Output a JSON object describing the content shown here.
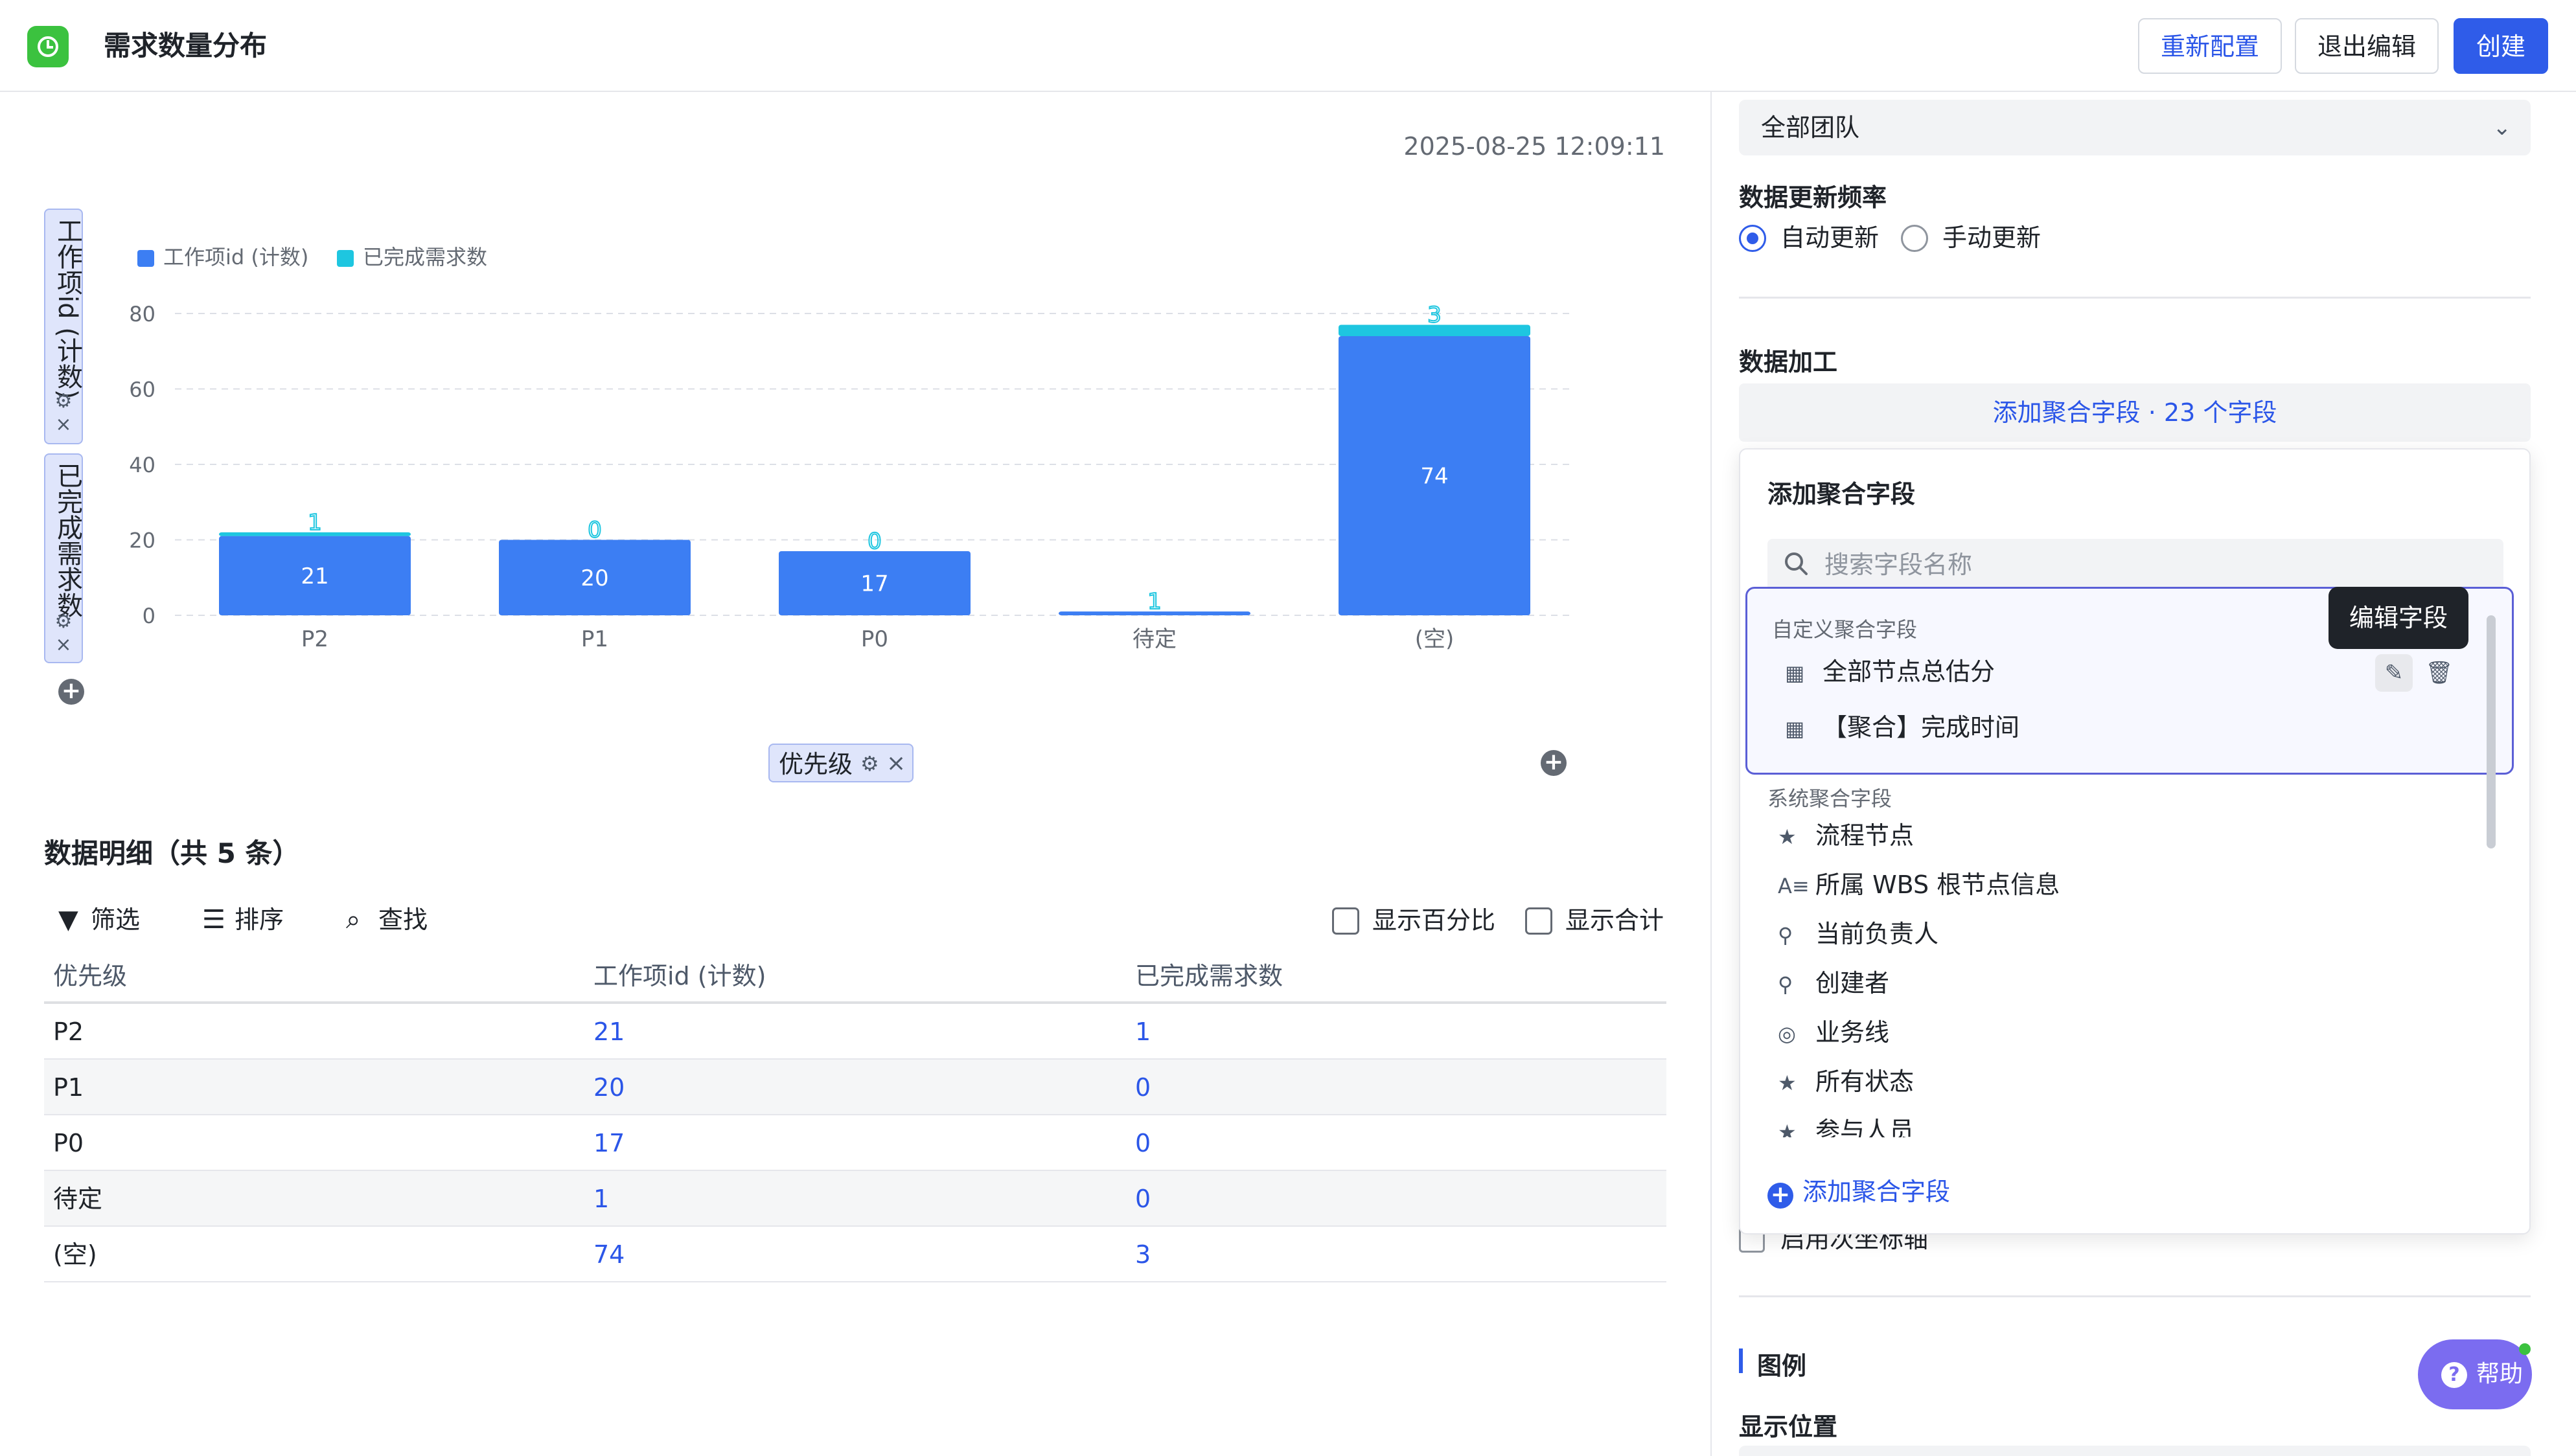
{
  "header": {
    "title": "需求数量分布",
    "reconfigure_label": "重新配置",
    "exit_edit_label": "退出编辑",
    "create_label": "创建"
  },
  "chart_panel": {
    "timestamp": "2025-08-25 12:09:11",
    "y_fields": [
      "工作项id (计数)",
      "已完成需求数"
    ],
    "x_field": "优先级"
  },
  "chart_data": {
    "type": "bar",
    "stacked": true,
    "categories": [
      "P2",
      "P1",
      "P0",
      "待定",
      "(空)"
    ],
    "series": [
      {
        "name": "工作项id (计数)",
        "values": [
          21,
          20,
          17,
          1,
          74
        ],
        "color": "#3c7ef3"
      },
      {
        "name": "已完成需求数",
        "values": [
          1,
          0,
          0,
          0,
          3
        ],
        "color": "#1ec6e0"
      }
    ],
    "yticks": [
      0,
      20,
      40,
      60,
      80
    ],
    "ylim": [
      0,
      80
    ],
    "grid": true,
    "legend": "top-left"
  },
  "detail": {
    "title": "数据明细（共 5 条）",
    "toolbar": {
      "filter": "筛选",
      "sort": "排序",
      "find": "查找"
    },
    "show_percent": "显示百分比",
    "show_total": "显示合计",
    "columns": [
      "优先级",
      "工作项id (计数)",
      "已完成需求数"
    ],
    "rows": [
      [
        "P2",
        "21",
        "1"
      ],
      [
        "P1",
        "20",
        "0"
      ],
      [
        "P0",
        "17",
        "0"
      ],
      [
        "待定",
        "1",
        "0"
      ],
      [
        "(空)",
        "74",
        "3"
      ]
    ]
  },
  "settings": {
    "team_value": "全部团队",
    "update_freq_label": "数据更新频率",
    "auto_update": "自动更新",
    "manual_update": "手动更新",
    "auto_selected": true,
    "processing_label": "数据加工",
    "add_agg_bar": "添加聚合字段 · 23 个字段",
    "hidden_option": "启用次坐标轴",
    "legend_label": "图例",
    "legend_position_label": "显示位置",
    "help_label": "帮助"
  },
  "popover": {
    "title": "添加聚合字段",
    "search_placeholder": "搜索字段名称",
    "custom_group_title": "自定义聚合字段",
    "custom_fields": [
      {
        "label": "全部节点总估分",
        "icon": "number-field-icon"
      },
      {
        "label": "【聚合】完成时间",
        "icon": "date-field-icon"
      }
    ],
    "tooltip": "编辑字段",
    "system_group_title": "系统聚合字段",
    "system_fields": [
      {
        "label": "流程节点",
        "icon": "workflow-icon"
      },
      {
        "label": "所属 WBS 根节点信息",
        "icon": "text-field-icon"
      },
      {
        "label": "当前负责人",
        "icon": "user-icon"
      },
      {
        "label": "创建者",
        "icon": "user-icon"
      },
      {
        "label": "业务线",
        "icon": "option-icon"
      },
      {
        "label": "所有状态",
        "icon": "workflow-icon"
      },
      {
        "label": "参与人员",
        "icon": "workflow-icon"
      }
    ],
    "add_field_label": "添加聚合字段"
  }
}
